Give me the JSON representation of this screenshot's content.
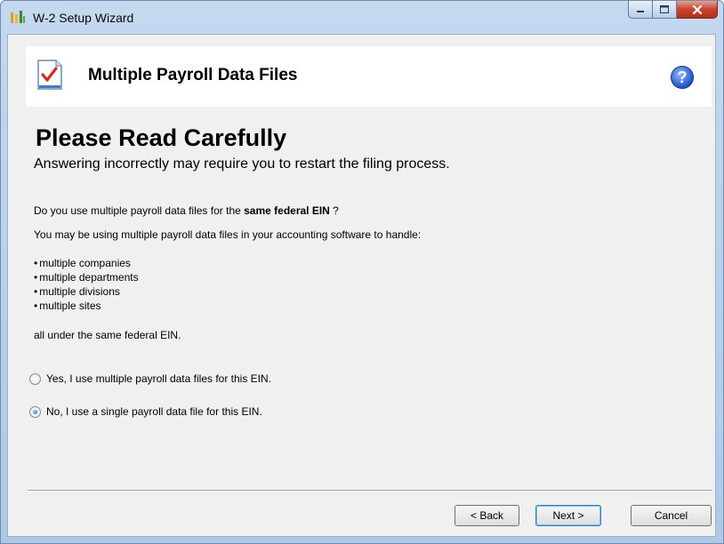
{
  "window": {
    "title": "W-2 Setup Wizard"
  },
  "header": {
    "title": "Multiple Payroll Data Files",
    "help_symbol": "?"
  },
  "content": {
    "heading": "Please Read Carefully",
    "subheading": "Answering incorrectly may require you to restart the filing process.",
    "question_prefix": "Do you use multiple payroll data files for the ",
    "question_bold": "same federal EIN",
    "question_suffix": " ?",
    "intro": "You may be using multiple payroll data files in your accounting software to handle:",
    "bullets": [
      "multiple companies",
      "multiple departments",
      "multiple divisions",
      "multiple sites"
    ],
    "footer_line": "all under the same federal EIN."
  },
  "options": [
    {
      "label": "Yes, I use multiple payroll data files for this EIN.",
      "selected": false
    },
    {
      "label": "No, I use a single payroll data file for this EIN.",
      "selected": true
    }
  ],
  "buttons": {
    "back": "< Back",
    "next": "Next >",
    "cancel": "Cancel"
  },
  "colors": {
    "accent_blue": "#1f54c8",
    "checkmark_red": "#d62b1e",
    "close_red": "#c6452e"
  }
}
